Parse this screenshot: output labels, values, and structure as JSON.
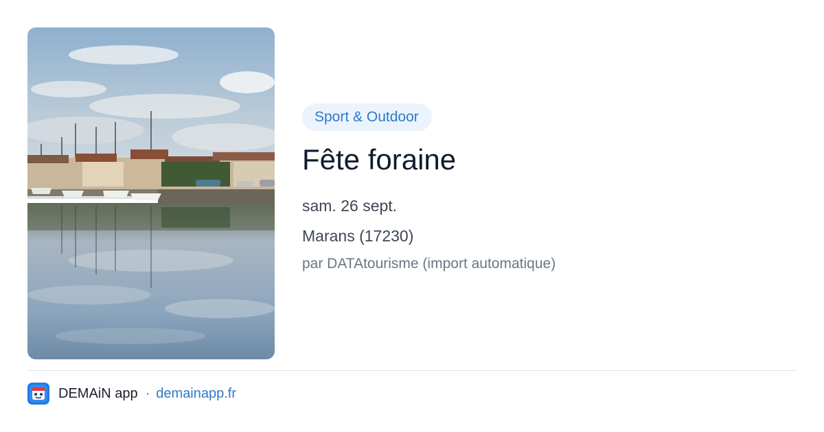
{
  "event": {
    "category": "Sport & Outdoor",
    "title": "Fête foraine",
    "date": "sam. 26 sept.",
    "location": "Marans (17230)",
    "source": "par DATAtourisme (import automatique)"
  },
  "image": {
    "subject": "harbor-with-sailboats-reflection"
  },
  "footer": {
    "app_name": "DEMAiN app",
    "separator": "·",
    "domain": "demainapp.fr"
  },
  "colors": {
    "accent": "#2f79c7",
    "tag_background": "#ebf3fc",
    "title": "#0f1c2e",
    "text": "#3d4654",
    "muted": "#6b7682"
  }
}
